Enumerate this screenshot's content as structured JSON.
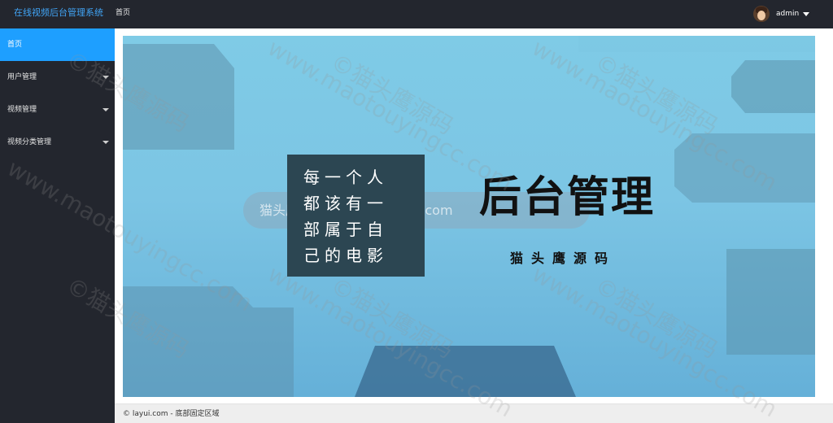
{
  "header": {
    "app_title": "在线视频后台管理系统",
    "nav_home": "首页",
    "username": "admin"
  },
  "sidebar": {
    "items": [
      {
        "label": "首页",
        "active": true,
        "expandable": false
      },
      {
        "label": "用户管理",
        "active": false,
        "expandable": true
      },
      {
        "label": "视频管理",
        "active": false,
        "expandable": true
      },
      {
        "label": "视频分类管理",
        "active": false,
        "expandable": true
      }
    ]
  },
  "banner": {
    "quote_lines": [
      "每一个人",
      "都该有一",
      "部属于自",
      "己的电影"
    ],
    "title": "后台管理",
    "subtitle": "猫头鹰源码",
    "watermark_bar": "猫头鹰源码 maotouyingcc.com"
  },
  "watermark": {
    "text_cn": "©猫头鹰源码",
    "text_url": "www.maotouyingcc.com"
  },
  "footer": {
    "text": "© layui.com - 底部固定区域"
  },
  "colors": {
    "header_bg": "#23262e",
    "active_nav": "#1e9fff",
    "logo_text": "#41a4f5",
    "banner_bg": "#7fcbe6",
    "quote_bg": "#2c4652"
  }
}
